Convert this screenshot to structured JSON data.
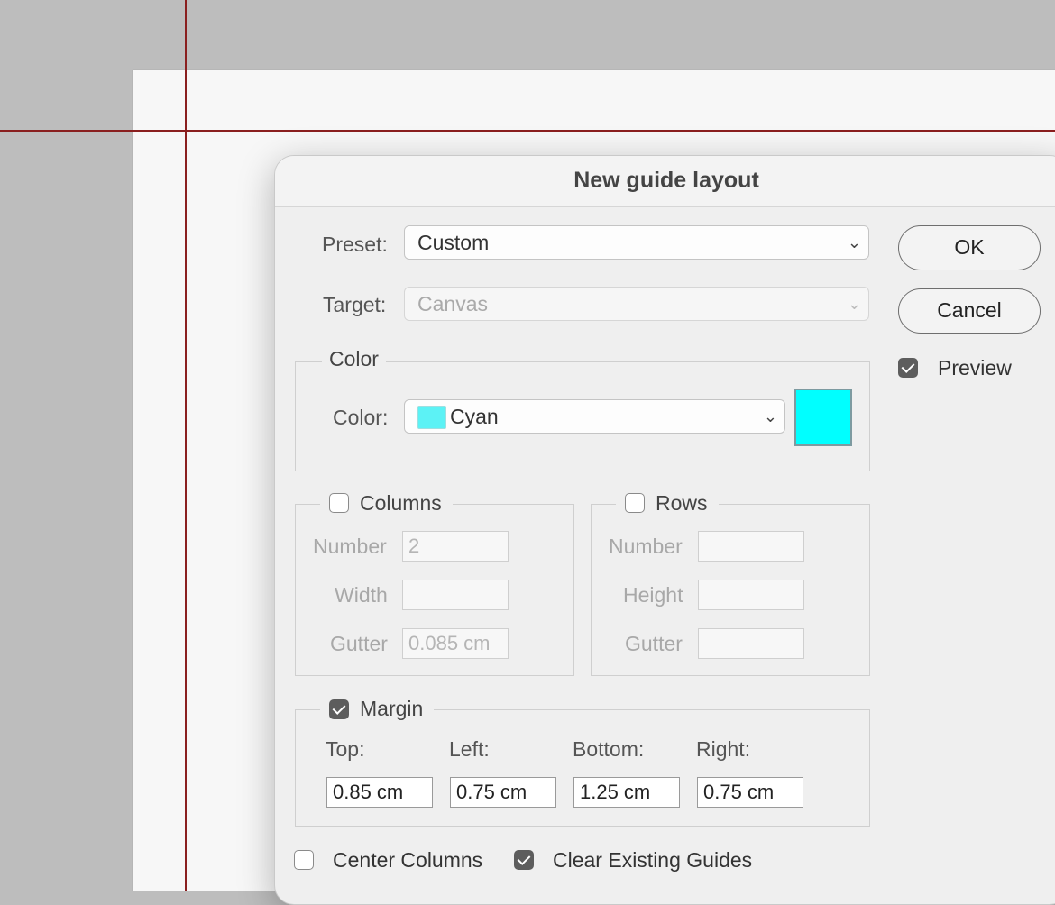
{
  "dialog": {
    "title": "New guide layout"
  },
  "preset": {
    "label": "Preset:",
    "value": "Custom"
  },
  "target": {
    "label": "Target:",
    "value": "Canvas"
  },
  "buttons": {
    "ok": "OK",
    "cancel": "Cancel"
  },
  "preview": {
    "label": "Preview",
    "checked": true
  },
  "color_group": {
    "legend": "Color",
    "label": "Color:",
    "value": "Cyan",
    "swatch_hex": "#00ffff"
  },
  "columns": {
    "legend": "Columns",
    "checked": false,
    "number_label": "Number",
    "number_value": "2",
    "width_label": "Width",
    "width_value": "",
    "gutter_label": "Gutter",
    "gutter_value": "0.085 cm"
  },
  "rows": {
    "legend": "Rows",
    "checked": false,
    "number_label": "Number",
    "number_value": "",
    "height_label": "Height",
    "height_value": "",
    "gutter_label": "Gutter",
    "gutter_value": ""
  },
  "margin": {
    "legend": "Margin",
    "checked": true,
    "top_label": "Top:",
    "top_value": "0.85 cm",
    "left_label": "Left:",
    "left_value": "0.75 cm",
    "bottom_label": "Bottom:",
    "bottom_value": "1.25 cm",
    "right_label": "Right:",
    "right_value": "0.75 cm"
  },
  "options": {
    "center_columns": {
      "label": "Center Columns",
      "checked": false
    },
    "clear_existing": {
      "label": "Clear Existing Guides",
      "checked": true
    }
  },
  "colors": {
    "guide": "#8a1f1f",
    "canvas_bg": "#bdbdbd"
  }
}
